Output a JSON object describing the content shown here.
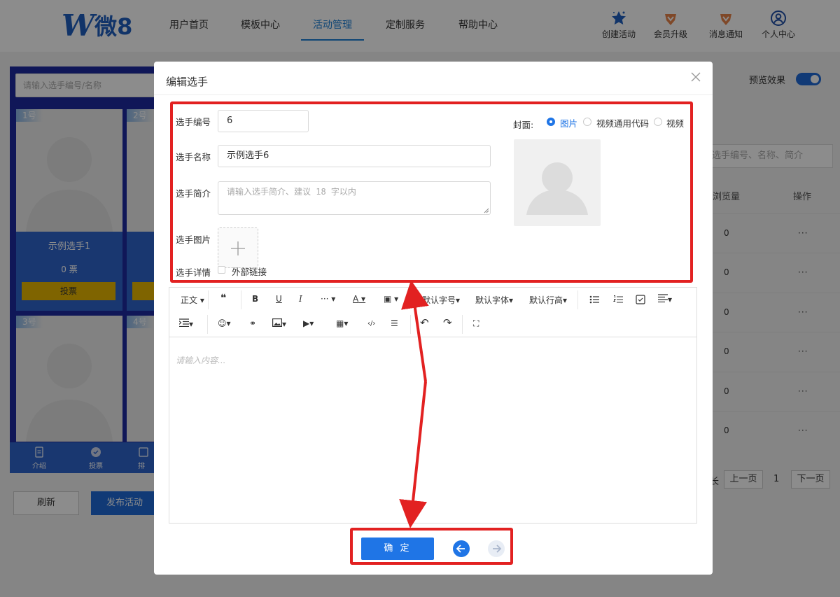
{
  "logo": {
    "brand": "W",
    "text": "微8"
  },
  "nav": {
    "items": [
      {
        "label": "用户首页"
      },
      {
        "label": "模板中心"
      },
      {
        "label": "活动管理"
      },
      {
        "label": "定制服务"
      },
      {
        "label": "帮助中心"
      }
    ]
  },
  "tools": [
    {
      "label": "创建活动",
      "icon": "star-icon"
    },
    {
      "label": "会员升级",
      "icon": "vip-icon"
    },
    {
      "label": "消息通知",
      "icon": "notice-icon"
    },
    {
      "label": "个人中心",
      "icon": "user-icon"
    }
  ],
  "background": {
    "search_placeholder": "请输入选手编号/名称",
    "cards": [
      {
        "num": "1号",
        "name": "示例选手1",
        "votes": "0 票",
        "vote_label": "投票"
      },
      {
        "num": "2号"
      },
      {
        "num": "3号"
      },
      {
        "num": "4号"
      }
    ],
    "tabs": [
      {
        "label": "介绍"
      },
      {
        "label": "投票"
      },
      {
        "label": "排"
      }
    ],
    "refresh": "刷新",
    "publish": "发布活动",
    "preview": "预览效果",
    "table_search": "选手编号、名称、简介",
    "col_views": "浏览量",
    "col_ops": "操作",
    "rows": [
      {
        "views": "0"
      },
      {
        "views": "0"
      },
      {
        "views": "0"
      },
      {
        "views": "0"
      },
      {
        "views": "0"
      },
      {
        "views": "0"
      }
    ],
    "ops_dots": "···",
    "pager_prev": "上一页",
    "pager_page": "1",
    "pager_next": "下一页",
    "pager_cut": "长"
  },
  "dialog": {
    "title": "编辑选手",
    "fields": {
      "number_label": "选手编号",
      "number_value": "6",
      "name_label": "选手名称",
      "name_value": "示例选手6",
      "intro_label": "选手简介",
      "intro_placeholder": "请输入选手简介、建议 18 字以内",
      "image_label": "选手图片",
      "detail_label": "选手详情",
      "external_link": "外部链接"
    },
    "cover": {
      "label": "封面:",
      "options": [
        {
          "label": "图片",
          "selected": true
        },
        {
          "label": "视频通用代码",
          "selected": false
        },
        {
          "label": "视频",
          "selected": false
        }
      ]
    },
    "toolbar": {
      "row1": [
        "正文",
        "❝",
        "B",
        "U",
        "I",
        "···",
        "A",
        "▣",
        "默认字号",
        "默认字体",
        "默认行高"
      ],
      "row2": [
        "☺",
        "⚭",
        "▦",
        "▶",
        "▦",
        "‹/›",
        "☰",
        "↶",
        "↷",
        "⛶"
      ]
    },
    "editor_placeholder": "请输入内容...",
    "confirm": "确 定"
  },
  "accent": "#1f75e6",
  "highlight": "#e22121"
}
